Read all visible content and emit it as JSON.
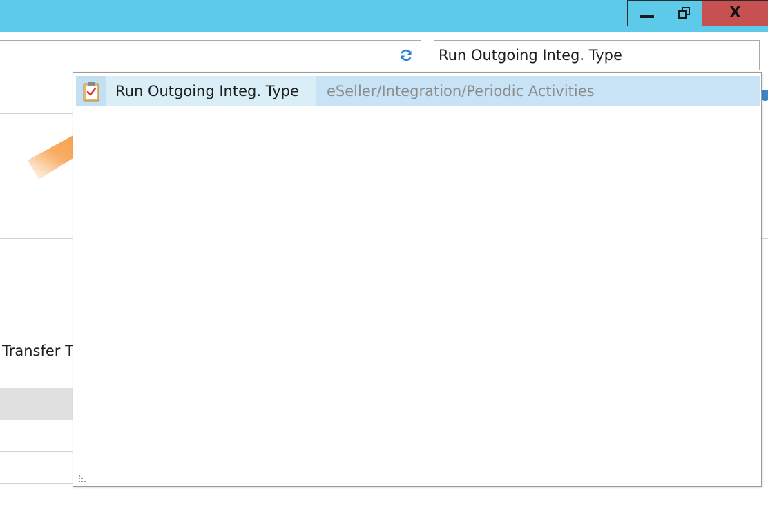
{
  "window": {
    "minimize_icon": "minimize-icon",
    "restore_icon": "restore-icon",
    "close_label": "X",
    "titlebar_color": "#5ecaea",
    "close_color": "#c75050"
  },
  "toolbar": {
    "refresh_icon": "refresh-icon"
  },
  "search": {
    "value": "Run Outgoing Integ. Type"
  },
  "background": {
    "transfer_label": "Transfer T"
  },
  "dropdown": {
    "results": [
      {
        "icon": "clipboard-check-icon",
        "name": "Run Outgoing Integ. Type",
        "path": "eSeller/Integration/Periodic Activities"
      }
    ],
    "highlight_color": "#c9e3f6"
  },
  "annotation": {
    "arrow_color": "#f5922f",
    "icon": "arrow-pointer-icon"
  }
}
